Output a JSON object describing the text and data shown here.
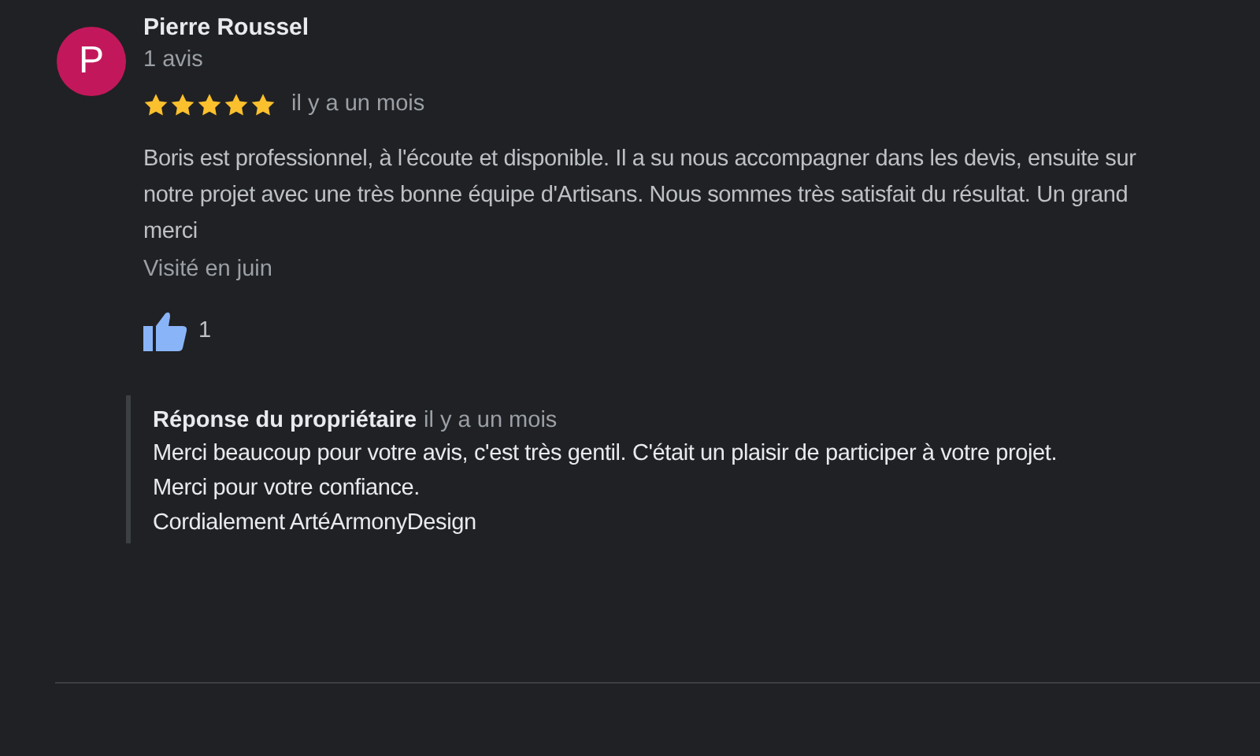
{
  "review": {
    "avatar_letter": "P",
    "author": "Pierre Roussel",
    "author_meta": "1 avis",
    "stars": 5,
    "time": "il y a un mois",
    "text": "Boris est professionnel, à l'écoute et disponible. Il a su nous accompagner dans les devis, ensuite sur notre projet avec une très bonne équipe d'Artisans. Nous sommes très satisfait du résultat. Un grand merci",
    "visited": "Visité en juin",
    "likes": "1"
  },
  "owner_response": {
    "title": "Réponse du propriétaire",
    "time": "il y a un mois",
    "lines": [
      "Merci beaucoup pour votre avis, c'est très gentil. C'était un plaisir de participer à votre projet. Merci pour votre confiance.",
      "Cordialement ArtéArmonyDesign"
    ]
  }
}
